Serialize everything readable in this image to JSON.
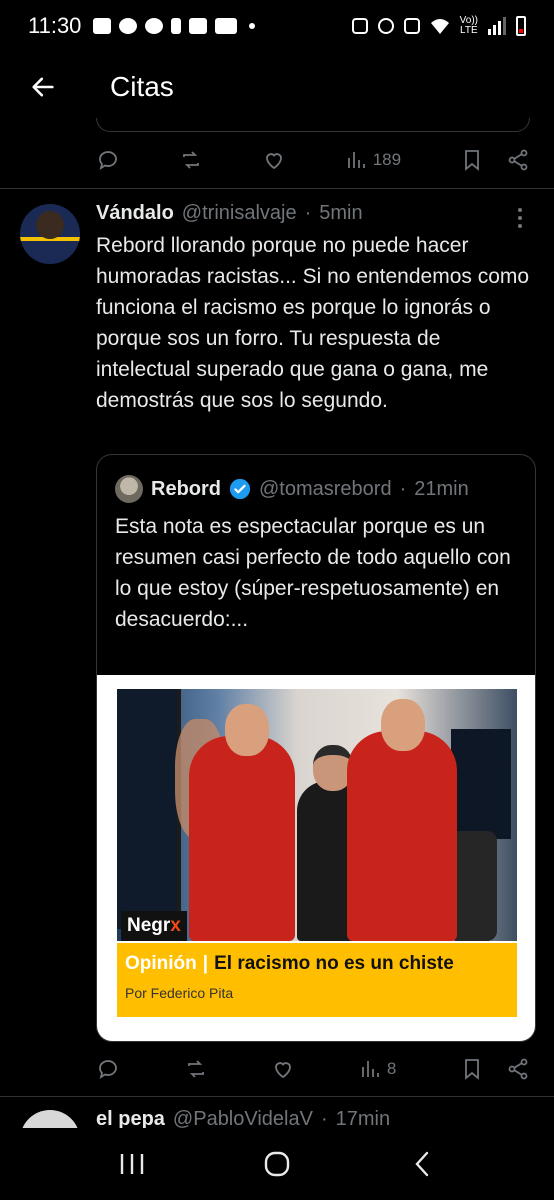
{
  "status_bar": {
    "time": "11:30",
    "net_top": "Vo))",
    "net_bottom": "LTE"
  },
  "header": {
    "title": "Citas"
  },
  "prev_tweet": {
    "actions": {
      "views": "189"
    }
  },
  "tweet": {
    "name": "Vándalo",
    "handle": "@trinisalvaje",
    "separator": "·",
    "time": "5min",
    "text": "Rebord llorando porque no puede hacer humoradas racistas... Si no entendemos como funciona el racismo es porque lo ignorás o porque sos un forro. Tu respuesta de intelectual superado que gana o gana, me demostrás que sos lo segundo.",
    "actions": {
      "views": "8"
    },
    "quote": {
      "name": "Rebord",
      "handle": "@tomasrebord",
      "separator": "·",
      "time": "21min",
      "text": "Esta nota es espectacular porque es un resumen casi perfecto de todo aquello con lo que estoy (súper-respetuosamente) en desacuerdo:...",
      "media": {
        "logo_main": "Negr",
        "logo_accent": "x",
        "section": "Opinión",
        "section_sep": "|",
        "headline": "El racismo no es un chiste",
        "byline": "Por Federico Pita"
      }
    }
  },
  "next_tweet": {
    "name": "el pepa",
    "handle": "@PabloVidelaV",
    "separator": "·",
    "time": "17min"
  },
  "colors": {
    "accent": "#1d9bf0",
    "muted": "#71767b",
    "banner": "#ffbf00",
    "logo_accent": "#f04a14"
  },
  "icons": [
    "back-arrow-icon",
    "reply-icon",
    "retweet-icon",
    "like-icon",
    "views-icon",
    "bookmark-icon",
    "share-icon",
    "more-icon",
    "verified-icon",
    "recents-icon",
    "home-icon",
    "back-nav-icon"
  ]
}
